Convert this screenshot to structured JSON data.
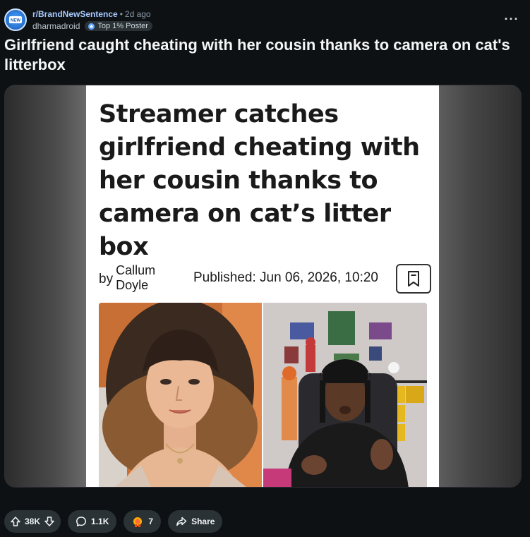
{
  "post": {
    "subreddit": "r/BrandNewSentence",
    "time_separator": "•",
    "time_ago": "2d ago",
    "author": "dharmadroid",
    "author_flair": "Top 1% Poster",
    "more_label": "···",
    "title": "Girlfriend caught cheating with her cousin thanks to camera on cat's litterbox"
  },
  "article": {
    "headline": "Streamer catches girlfriend cheating with her cousin thanks to camera on cat’s litter box",
    "by_label": "by",
    "author_first": "Callum",
    "author_last": "Doyle",
    "published": "Published: Jun 06, 2026, 10:20"
  },
  "actions": {
    "upvotes": "38K",
    "comments": "1.1K",
    "awards": "7",
    "share_label": "Share"
  },
  "icons": {
    "subreddit_avatar": "subreddit-snoo-icon",
    "flair": "top-poster-icon",
    "bookmark": "bookmark-icon",
    "upvote": "upvote-arrow-icon",
    "downvote": "downvote-arrow-icon",
    "comment": "comment-bubble-icon",
    "award": "award-icon",
    "share": "share-arrow-icon"
  },
  "colors": {
    "background": "#0e1113",
    "subreddit_link": "#a7c8ff",
    "pill_bg": "#2a3236"
  }
}
